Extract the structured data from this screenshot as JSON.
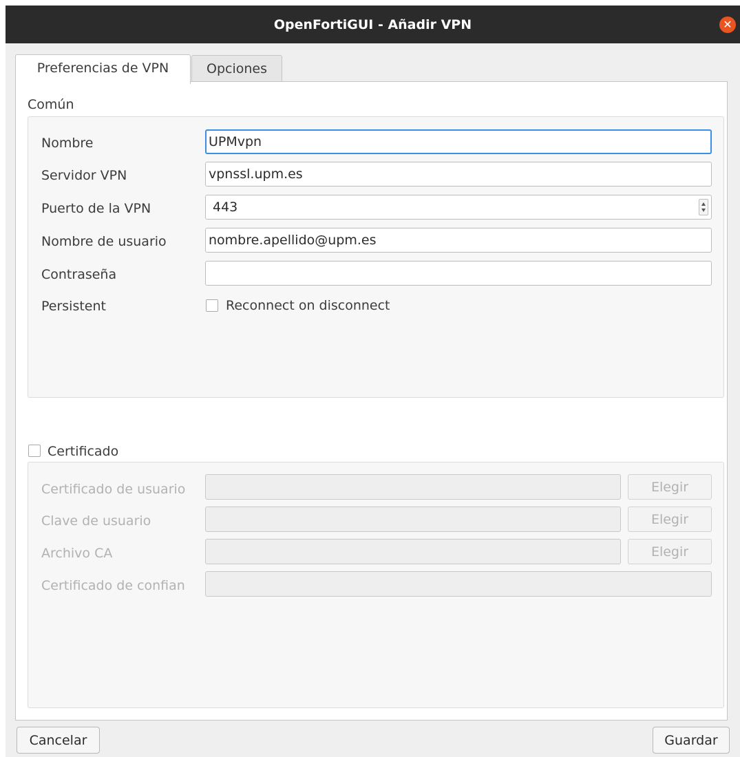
{
  "window": {
    "title": "OpenFortiGUI - Añadir VPN",
    "close_icon": "close-icon",
    "accent_color": "#e95420"
  },
  "tabs": [
    {
      "label": "Preferencias de VPN",
      "active": true
    },
    {
      "label": "Opciones",
      "active": false
    }
  ],
  "common": {
    "section_label": "Común",
    "fields": {
      "name": {
        "label": "Nombre",
        "value": "UPMvpn"
      },
      "server": {
        "label": "Servidor VPN",
        "value": "vpnssl.upm.es"
      },
      "port": {
        "label": "Puerto de la VPN",
        "value": "443"
      },
      "username": {
        "label": "Nombre de usuario",
        "value": "nombre.apellido@upm.es"
      },
      "password": {
        "label": "Contraseña",
        "value": ""
      }
    },
    "persistent": {
      "label": "Persistent",
      "checkbox_label": "Reconnect on disconnect",
      "checked": false
    }
  },
  "certificate": {
    "checkbox_label": "Certificado",
    "checked": false,
    "fields": {
      "user_cert": {
        "label": "Certificado de usuario",
        "value": "",
        "button": "Elegir"
      },
      "user_key": {
        "label": "Clave de usuario",
        "value": "",
        "button": "Elegir"
      },
      "ca_file": {
        "label": "Archivo CA",
        "value": "",
        "button": "Elegir"
      },
      "trusted_cert": {
        "label": "Certificado de confian",
        "value": ""
      }
    }
  },
  "footer": {
    "cancel_label": "Cancelar",
    "save_label": "Guardar"
  }
}
